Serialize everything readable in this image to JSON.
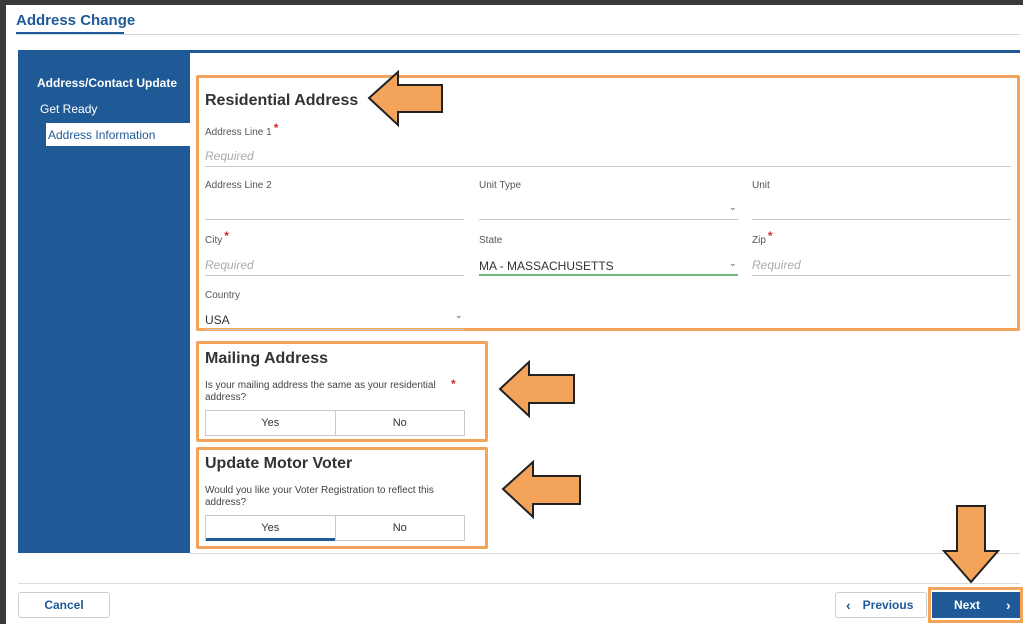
{
  "page": {
    "title": "Address Change"
  },
  "sidebar": {
    "heading": "Address/Contact Update",
    "items": [
      {
        "label": "Get Ready"
      },
      {
        "label": "Address Information"
      }
    ]
  },
  "residential": {
    "title": "Residential Address",
    "address1": {
      "label": "Address Line 1",
      "placeholder": "Required"
    },
    "address2": {
      "label": "Address Line 2",
      "value": ""
    },
    "unit_type": {
      "label": "Unit Type",
      "value": ""
    },
    "unit": {
      "label": "Unit",
      "value": ""
    },
    "city": {
      "label": "City",
      "placeholder": "Required"
    },
    "state": {
      "label": "State",
      "value": "MA - MASSACHUSETTS"
    },
    "zip": {
      "label": "Zip",
      "placeholder": "Required"
    },
    "country": {
      "label": "Country",
      "value": "USA"
    }
  },
  "mailing": {
    "title": "Mailing Address",
    "question": "Is your mailing address the same as your residential address?",
    "options": [
      "Yes",
      "No"
    ]
  },
  "motor_voter": {
    "title": "Update Motor Voter",
    "question": "Would you like your Voter Registration to reflect this address?",
    "options": [
      "Yes",
      "No"
    ],
    "selected": "Yes"
  },
  "footer": {
    "cancel_label": "Cancel",
    "previous_label": "Previous",
    "next_label": "Next",
    "prev_chevron": "‹",
    "next_chevron": "›"
  },
  "colors": {
    "primary": "#1f5a96",
    "highlight": "#f4a35b",
    "required": "#d7262d",
    "focus": "#6fb97e"
  }
}
